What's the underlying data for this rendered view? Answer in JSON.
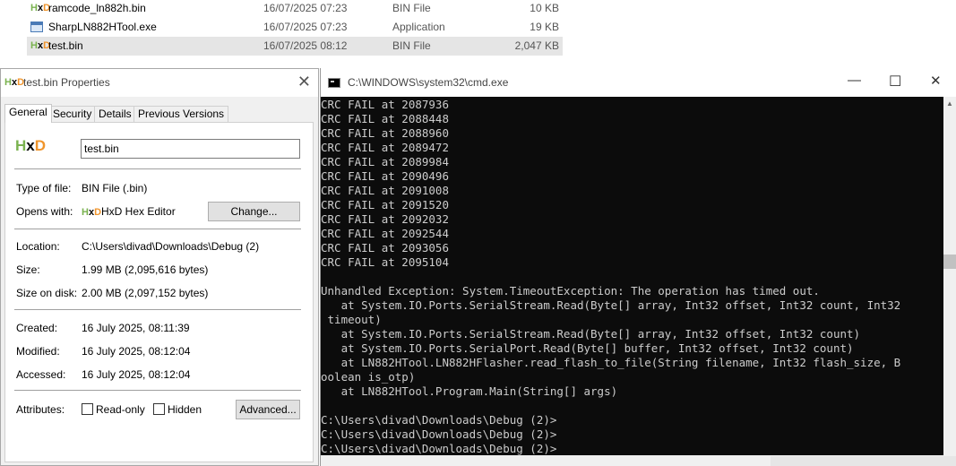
{
  "explorer": {
    "files": [
      {
        "name": "ramcode_ln882h.bin",
        "date": "16/07/2025 07:23",
        "type": "BIN File",
        "size": "10 KB",
        "icon": "hxd-file-icon"
      },
      {
        "name": "SharpLN882HTool.exe",
        "date": "16/07/2025 07:23",
        "type": "Application",
        "size": "19 KB",
        "icon": "application-icon"
      },
      {
        "name": "test.bin",
        "date": "16/07/2025 08:12",
        "type": "BIN File",
        "size": "2,047 KB",
        "icon": "hxd-file-icon"
      }
    ]
  },
  "properties": {
    "title": "test.bin Properties",
    "close_glyph": "✕",
    "tabs": [
      "General",
      "Security",
      "Details",
      "Previous Versions"
    ],
    "icon_letters": {
      "h": "H",
      "x": "x",
      "d": "D"
    },
    "file_name": "test.bin",
    "type_label": "Type of file:",
    "type_value": "BIN File (.bin)",
    "opens_label": "Opens with:",
    "opens_value": "HxD Hex Editor",
    "change_button": "Change...",
    "location_label": "Location:",
    "location_value": "C:\\Users\\divad\\Downloads\\Debug (2)",
    "size_label": "Size:",
    "size_value": "1.99 MB (2,095,616 bytes)",
    "size_on_disk_label": "Size on disk:",
    "size_on_disk_value": "2.00 MB (2,097,152 bytes)",
    "created_label": "Created:",
    "created_value": "16 July 2025, 08:11:39",
    "modified_label": "Modified:",
    "modified_value": "16 July 2025, 08:12:04",
    "accessed_label": "Accessed:",
    "accessed_value": "16 July 2025, 08:12:04",
    "attributes_label": "Attributes:",
    "readonly_label": "Read-only",
    "hidden_label": "Hidden",
    "advanced_button": "Advanced..."
  },
  "cmd": {
    "title": "C:\\WINDOWS\\system32\\cmd.exe",
    "minimize_glyph": "—",
    "maximize_glyph": "☐",
    "close_glyph": "✕",
    "output": "CRC FAIL at 2087936\nCRC FAIL at 2088448\nCRC FAIL at 2088960\nCRC FAIL at 2089472\nCRC FAIL at 2089984\nCRC FAIL at 2090496\nCRC FAIL at 2091008\nCRC FAIL at 2091520\nCRC FAIL at 2092032\nCRC FAIL at 2092544\nCRC FAIL at 2093056\nCRC FAIL at 2095104\n\nUnhandled Exception: System.TimeoutException: The operation has timed out.\n   at System.IO.Ports.SerialStream.Read(Byte[] array, Int32 offset, Int32 count, Int32\n timeout)\n   at System.IO.Ports.SerialStream.Read(Byte[] array, Int32 offset, Int32 count)\n   at System.IO.Ports.SerialPort.Read(Byte[] buffer, Int32 offset, Int32 count)\n   at LN882HTool.LN882HFlasher.read_flash_to_file(String filename, Int32 flash_size, B\noolean is_otp)\n   at LN882HTool.Program.Main(String[] args)\n\nC:\\Users\\divad\\Downloads\\Debug (2)>\nC:\\Users\\divad\\Downloads\\Debug (2)>\nC:\\Users\\divad\\Downloads\\Debug (2)>"
  }
}
